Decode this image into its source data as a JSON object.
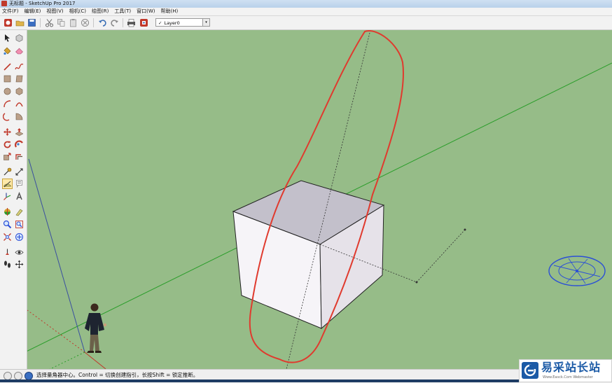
{
  "window": {
    "title": "无标题 - SketchUp Pro 2017"
  },
  "menu": [
    "文件(F)",
    "编辑(E)",
    "视图(V)",
    "相机(C)",
    "绘图(R)",
    "工具(T)",
    "窗口(W)",
    "帮助(H)"
  ],
  "toolbar": {
    "icons": [
      "getting-started-icon",
      "open-icon",
      "save-icon",
      "cut-icon",
      "copy-icon",
      "paste-icon",
      "erase-icon",
      "undo-icon",
      "redo-icon",
      "print-icon",
      "model-info-icon"
    ],
    "layer": {
      "checkmark": "✓",
      "current": "Layer0",
      "dropdown": "▾"
    }
  },
  "left_tools": [
    "select-icon",
    "component-icon",
    "paint-bucket-icon",
    "eraser-icon",
    "line-icon",
    "freehand-icon",
    "rectangle-icon",
    "rotated-rectangle-icon",
    "circle-icon",
    "polygon-icon",
    "arc-icon",
    "pie-icon",
    "arc-2pt-icon",
    "arc-3pt-icon",
    "move-icon",
    "push-pull-icon",
    "rotate-icon",
    "follow-me-icon",
    "scale-icon",
    "offset-icon",
    "tape-measure-icon",
    "dimension-icon",
    "protractor-icon",
    "text-icon",
    "axes-icon",
    "3d-text-icon",
    "section-plane-icon",
    "paint-icon",
    "zoom-icon",
    "zoom-window-icon",
    "zoom-extents-icon",
    "pan-icon",
    "orbit-icon",
    "look-around-icon",
    "footprint-icon",
    "position-camera-icon"
  ],
  "status": {
    "message": "选择量角器中心。Control = 切换创建指引，长按Shift = 锁定推断。"
  },
  "watermark": {
    "name": "易采站长站",
    "sub": "Www.Easck.Com  Webmaster"
  },
  "colors": {
    "canvas": "#96bc88",
    "green_axis": "#2a9d2a",
    "blue_axis": "#3a4fa0",
    "red_axis": "#c0392b",
    "annotation": "#e03a2e",
    "protractor": "#2b4fd6"
  }
}
